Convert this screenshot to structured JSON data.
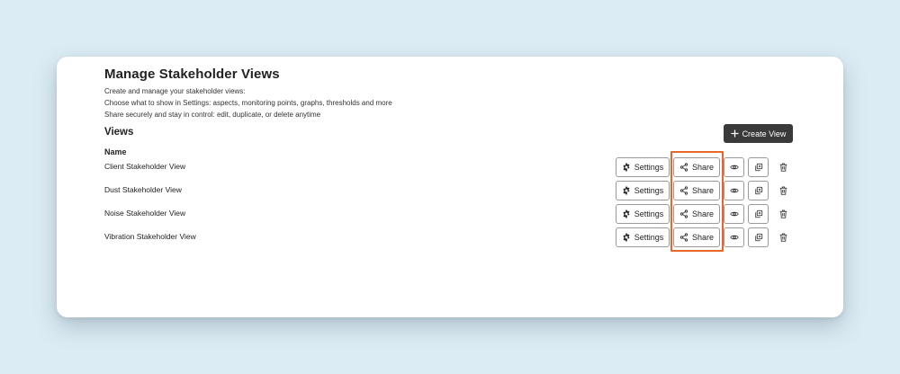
{
  "page": {
    "title": "Manage Stakeholder Views",
    "description_lines": [
      "Create and manage your stakeholder views:",
      "Choose what to show in Settings: aspects, monitoring points, graphs, thresholds and more",
      "Share securely and stay in control: edit, duplicate, or delete anytime"
    ]
  },
  "views_section": {
    "title": "Views",
    "create_button_label": "Create View",
    "create_icon": "plus-icon",
    "column_header": "Name",
    "rows": [
      {
        "name": "Client Stakeholder View"
      },
      {
        "name": "Dust Stakeholder View"
      },
      {
        "name": "Noise Stakeholder View"
      },
      {
        "name": "Vibration Stakeholder View"
      }
    ],
    "actions": {
      "settings_label": "Settings",
      "settings_icon": "gear-icon",
      "share_label": "Share",
      "share_icon": "share-icon",
      "view_icon": "eye-icon",
      "duplicate_icon": "duplicate-icon",
      "delete_icon": "trash-icon"
    }
  },
  "colors": {
    "background": "#dcecf4",
    "card": "#ffffff",
    "primary_button": "#3a3a3a",
    "highlight": "#e8672a"
  }
}
